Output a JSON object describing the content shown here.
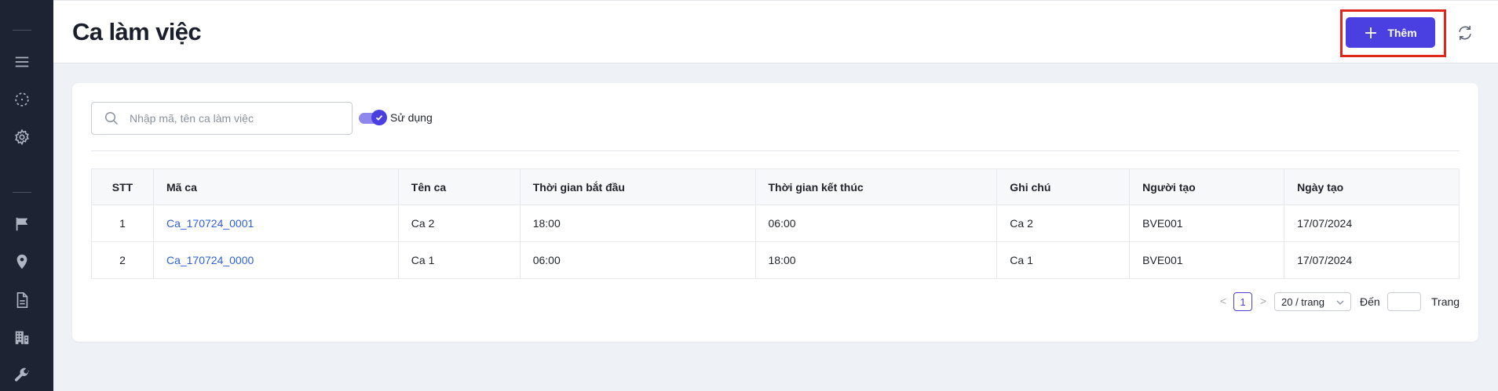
{
  "header": {
    "title": "Ca làm việc",
    "add_label": "Thêm"
  },
  "sidebar": {
    "icons": [
      "menu-icon",
      "scan-icon",
      "gear-icon",
      "flag-icon",
      "location-pin-icon",
      "document-icon",
      "building-icon",
      "wrench-icon"
    ]
  },
  "filter": {
    "search_placeholder": "Nhập mã, tên ca làm việc",
    "toggle_label": "Sử dụng",
    "toggle_on": true
  },
  "table": {
    "columns": [
      "STT",
      "Mã ca",
      "Tên ca",
      "Thời gian bắt đầu",
      "Thời gian kết thúc",
      "Ghi chú",
      "Người tạo",
      "Ngày tạo"
    ],
    "rows": [
      {
        "stt": "1",
        "code": "Ca_170724_0001",
        "name": "Ca 2",
        "start": "18:00",
        "end": "06:00",
        "note": "Ca 2",
        "creator": "BVE001",
        "created": "17/07/2024"
      },
      {
        "stt": "2",
        "code": "Ca_170724_0000",
        "name": "Ca 1",
        "start": "06:00",
        "end": "18:00",
        "note": "Ca 1",
        "creator": "BVE001",
        "created": "17/07/2024"
      }
    ]
  },
  "pagination": {
    "prev": "<",
    "current_page": "1",
    "next": ">",
    "page_size": "20 / trang",
    "goto_label": "Đến",
    "page_label": "Trang"
  },
  "colors": {
    "accent": "#4a3fe0",
    "link": "#2f5fd6",
    "sidebar_bg": "#1d2333",
    "highlight": "#e0271e"
  }
}
